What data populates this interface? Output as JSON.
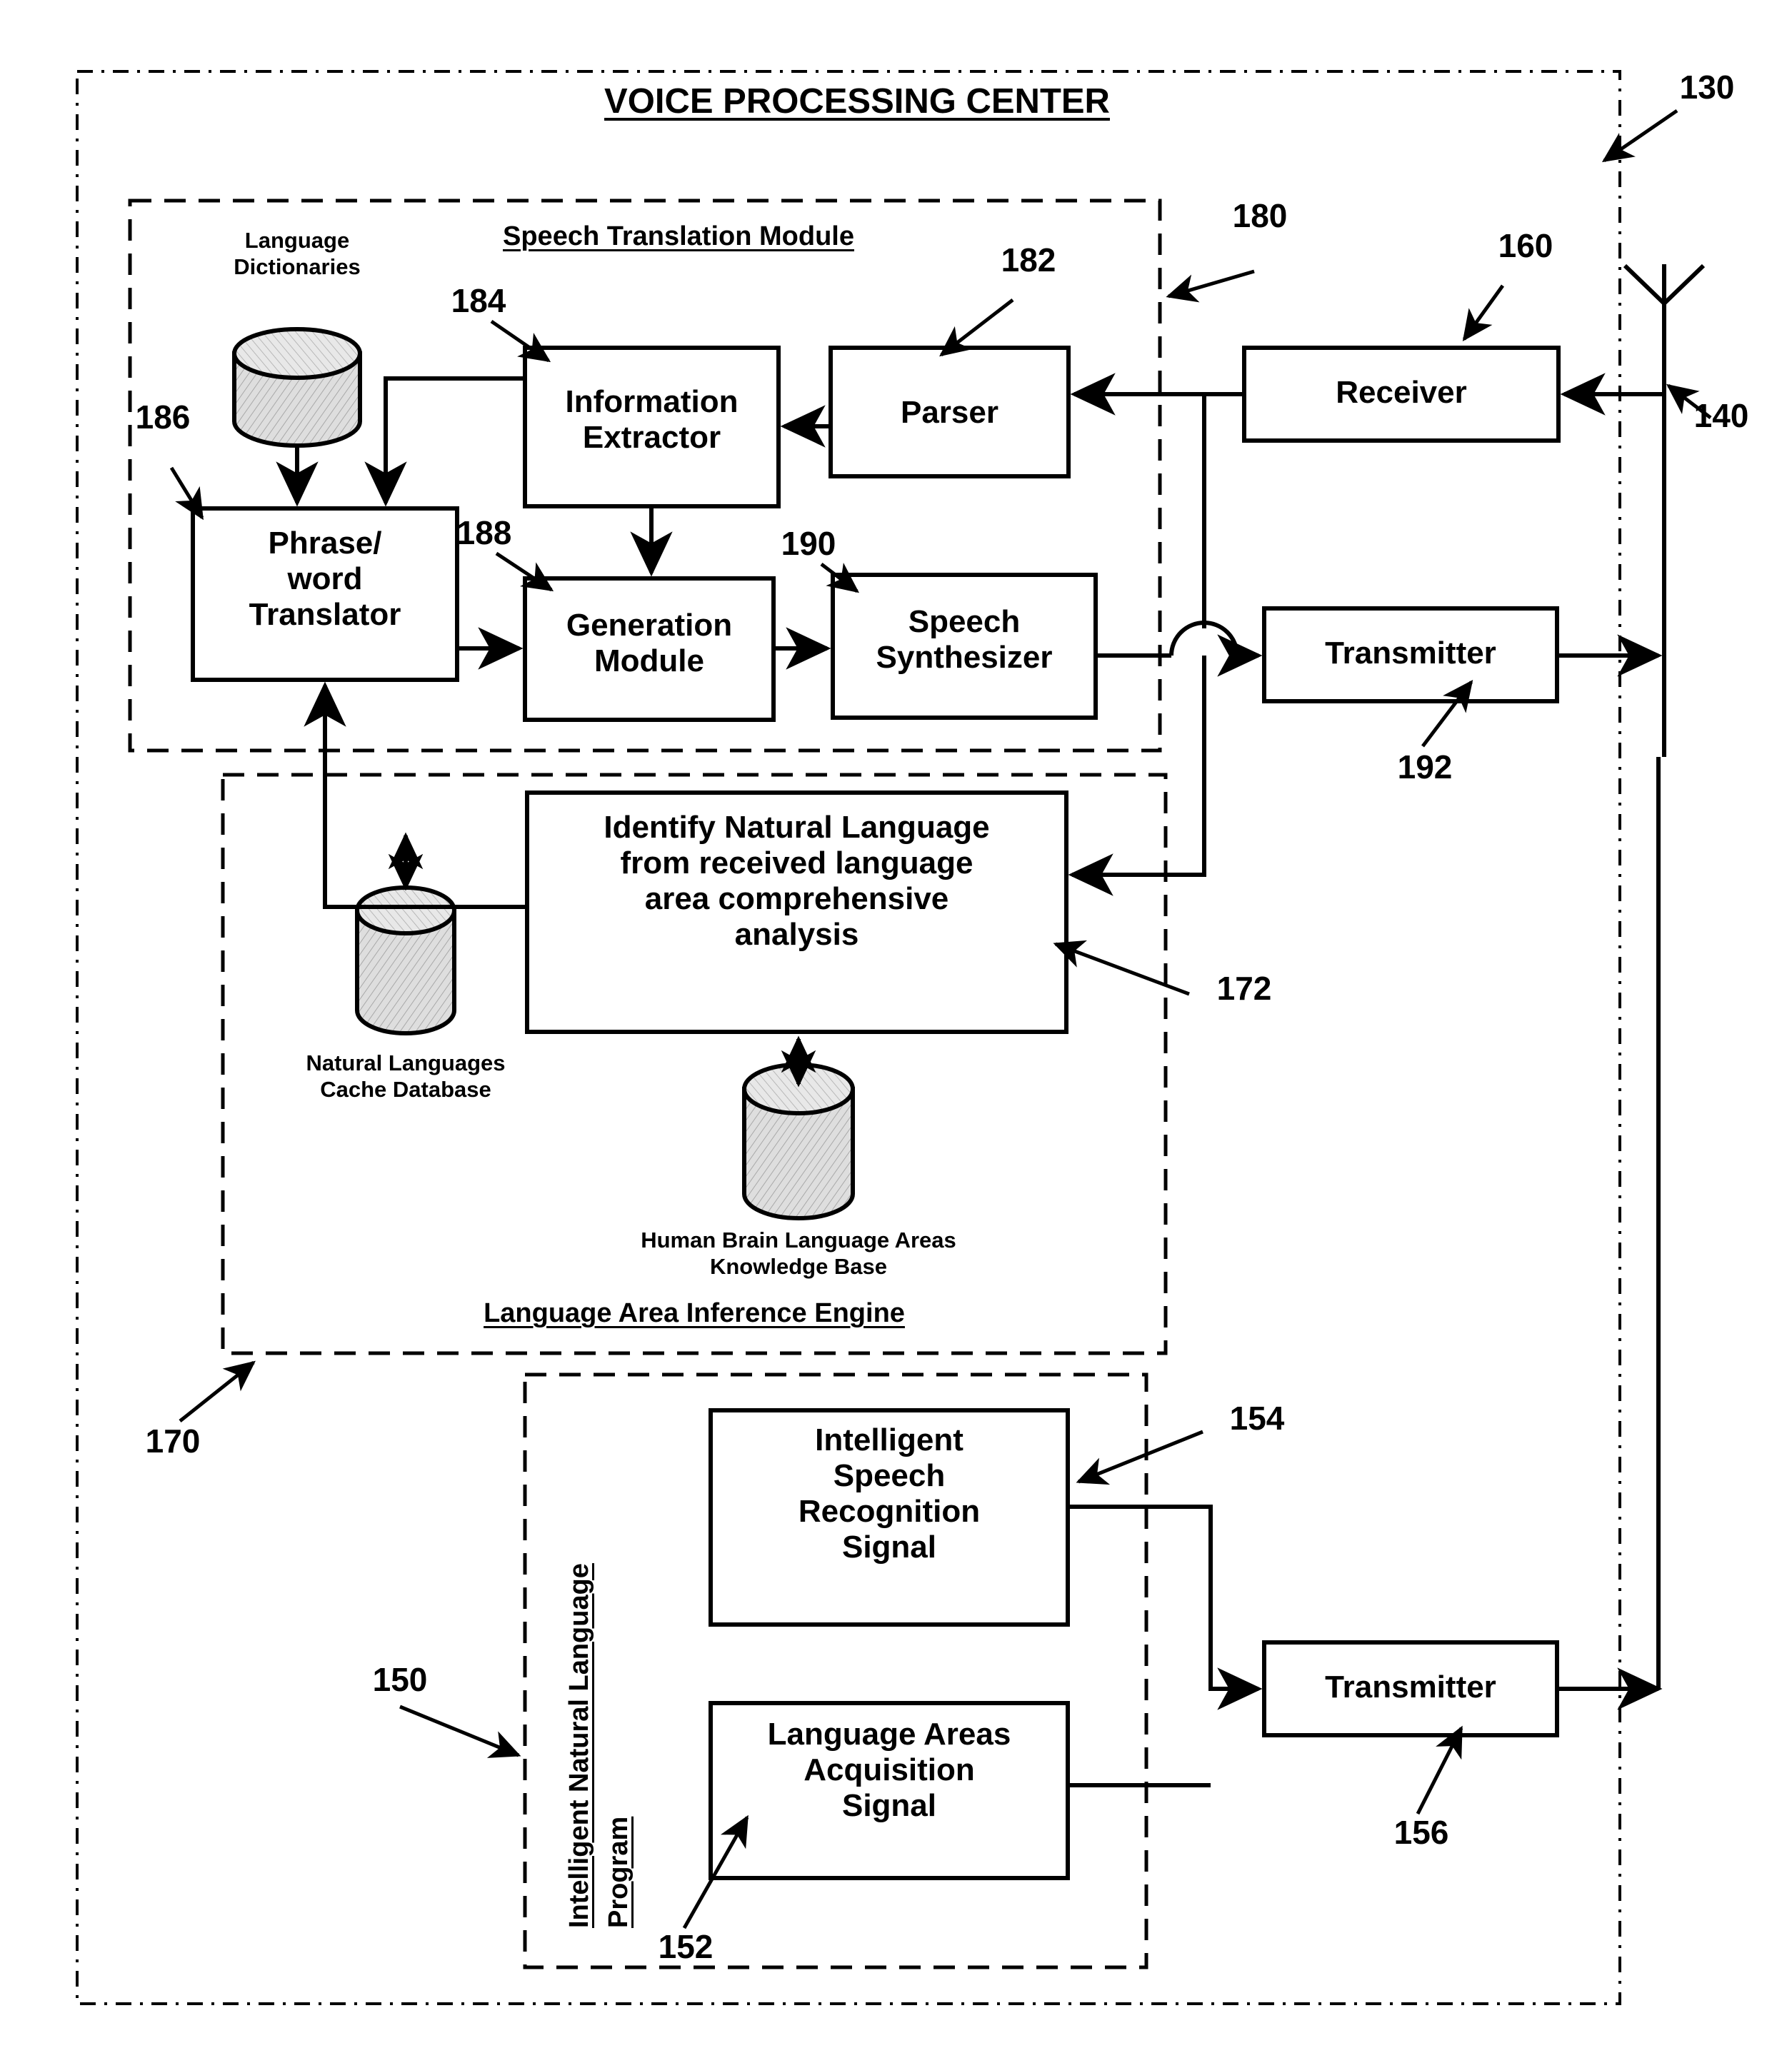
{
  "figure": {
    "title": "VOICE PROCESSING CENTER",
    "outer_ref": "130",
    "antenna_ref": "140"
  },
  "modules": {
    "speech_translation": {
      "label": "Speech Translation Module",
      "ref": "180"
    },
    "inference_engine": {
      "label": "Language Area Inference Engine",
      "ref": "170"
    },
    "intelligent_program": {
      "label_line1": "Intelligent Natural Language",
      "label_line2": "Program",
      "ref": "150"
    }
  },
  "boxes": {
    "information_extractor": {
      "label": "Information\nExtractor",
      "ref": "184"
    },
    "parser": {
      "label": "Parser",
      "ref": "182"
    },
    "receiver": {
      "label": "Receiver",
      "ref": "160"
    },
    "phrase_word_translator": {
      "label": "Phrase/\nword\nTranslator",
      "ref": "186"
    },
    "generation_module": {
      "label": "Generation\nModule",
      "ref": "188"
    },
    "speech_synthesizer": {
      "label": "Speech\nSynthesizer",
      "ref": "190"
    },
    "transmitter_top": {
      "label": "Transmitter",
      "ref": "192"
    },
    "identify_natural_language": {
      "label": "Identify Natural Language\nfrom received language\narea comprehensive\nanalysis",
      "ref": "172"
    },
    "intelligent_speech_recognition_signal": {
      "label": "Intelligent\nSpeech\nRecognition\nSignal",
      "ref": "154"
    },
    "language_areas_acquisition_signal": {
      "label": "Language Areas\nAcquisition\nSignal",
      "ref": "152"
    },
    "transmitter_bottom": {
      "label": "Transmitter",
      "ref": "156"
    }
  },
  "databases": {
    "language_dictionaries": {
      "caption": "Language\nDictionaries"
    },
    "natural_languages_cache": {
      "caption": "Natural Languages\nCache Database"
    },
    "human_brain_knowledge_base": {
      "caption": "Human Brain Language Areas\nKnowledge Base"
    }
  },
  "colors": {
    "ink": "#000000",
    "paper": "#ffffff",
    "cylinder_fill": "#d9d9d9",
    "cylinder_top": "#ebebeb"
  }
}
